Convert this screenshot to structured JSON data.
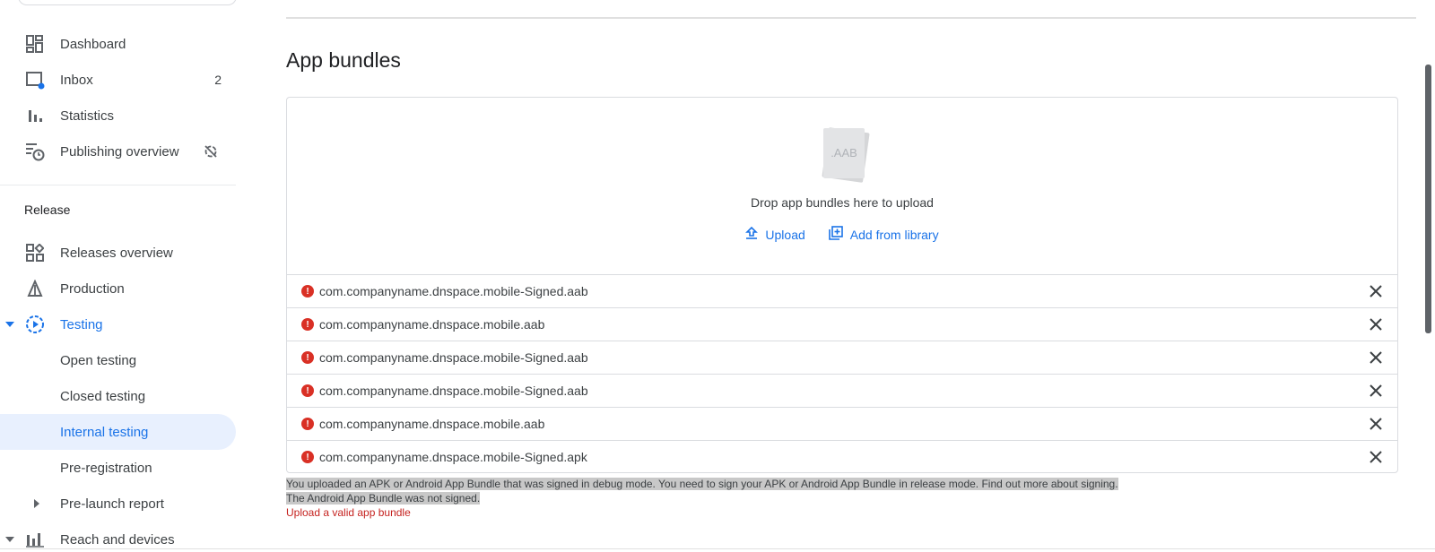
{
  "sidebar": {
    "top_items": [
      {
        "label": "Dashboard",
        "icon": "dashboard-icon"
      },
      {
        "label": "Inbox",
        "icon": "inbox-icon",
        "badge": "2"
      },
      {
        "label": "Statistics",
        "icon": "bar-chart-icon"
      },
      {
        "label": "Publishing overview",
        "icon": "publishing-icon"
      }
    ],
    "section_title": "Release",
    "release_items": [
      {
        "label": "Releases overview"
      },
      {
        "label": "Production"
      },
      {
        "label": "Testing"
      },
      {
        "label": "Open testing"
      },
      {
        "label": "Closed testing"
      },
      {
        "label": "Internal testing"
      },
      {
        "label": "Pre-registration"
      },
      {
        "label": "Pre-launch report"
      },
      {
        "label": "Reach and devices"
      }
    ]
  },
  "main": {
    "title": "App bundles",
    "drop": {
      "icon_label": ".AAB",
      "text": "Drop app bundles here to upload",
      "upload_label": "Upload",
      "library_label": "Add from library"
    },
    "files": [
      "com.companyname.dnspace.mobile-Signed.aab",
      "com.companyname.dnspace.mobile.aab",
      "com.companyname.dnspace.mobile-Signed.aab",
      "com.companyname.dnspace.mobile-Signed.aab",
      "com.companyname.dnspace.mobile.aab",
      "com.companyname.dnspace.mobile-Signed.apk"
    ],
    "error_line1": "You uploaded an APK or Android App Bundle that was signed in debug mode. You need to sign your APK or Android App Bundle in release mode. Find out more about signing.",
    "error_line2": "The Android App Bundle was not signed.",
    "error_line3": "Upload a valid app bundle"
  },
  "colors": {
    "accent": "#1a73e8",
    "error": "#d93025",
    "active_bg": "#e8f0fe"
  }
}
